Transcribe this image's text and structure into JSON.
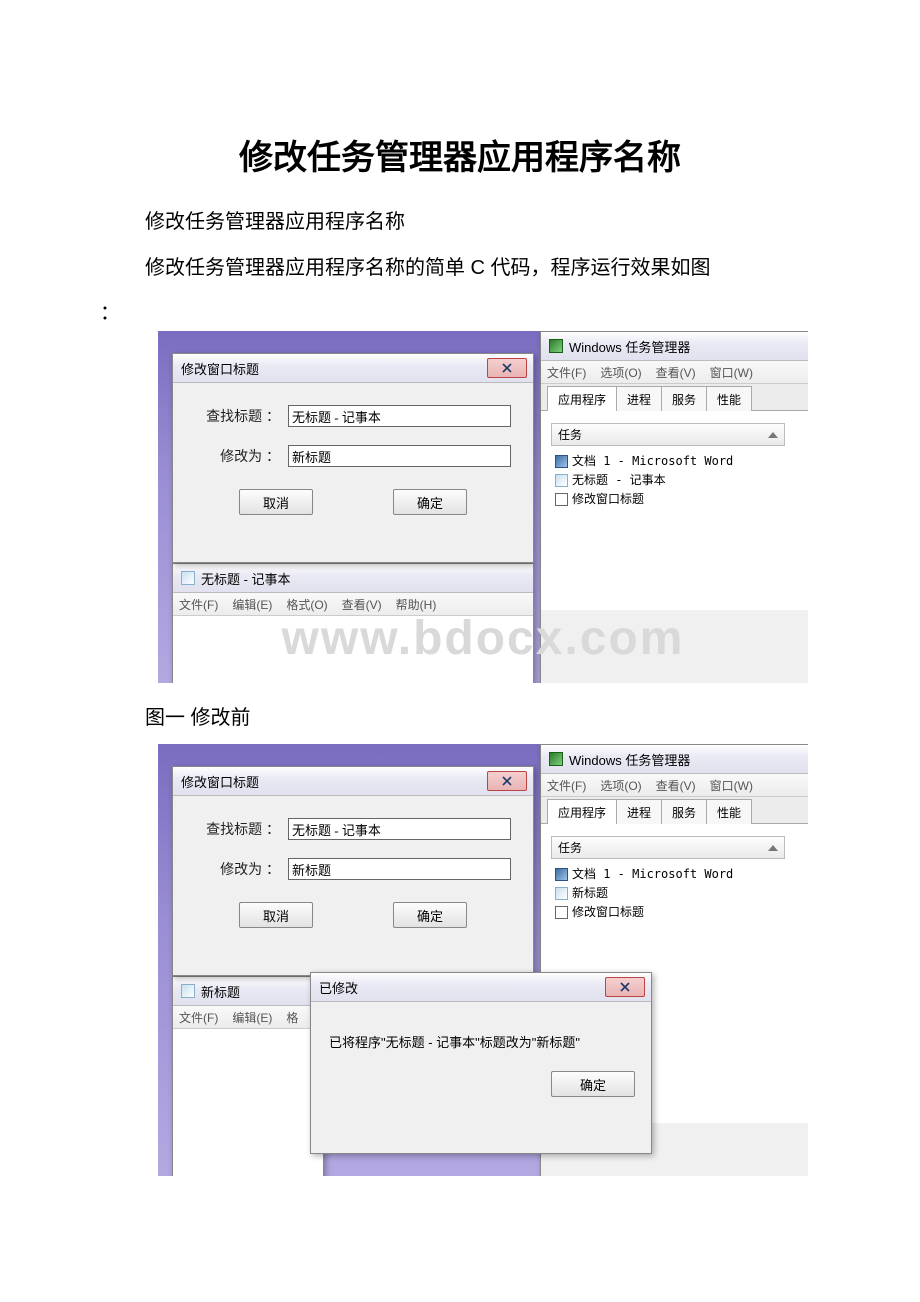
{
  "doc": {
    "title": "修改任务管理器应用程序名称",
    "line1": "修改任务管理器应用程序名称",
    "line2": "修改任务管理器应用程序名称的简单 C 代码，程序运行效果如图",
    "colon": "：",
    "caption1": "图一 修改前",
    "watermark": "www.bdocx.com"
  },
  "dialog": {
    "title": "修改窗口标题",
    "find_label": "查找标题 ：",
    "find_value": "无标题 - 记事本",
    "change_label": "修改为 ：",
    "change_value": "新标题",
    "cancel": "取消",
    "ok": "确定"
  },
  "notepad1": {
    "title": "无标题 - 记事本",
    "menu": [
      "文件(F)",
      "编辑(E)",
      "格式(O)",
      "查看(V)",
      "帮助(H)"
    ]
  },
  "notepad2": {
    "title": "新标题",
    "menu": [
      "文件(F)",
      "编辑(E)",
      "格"
    ]
  },
  "taskmgr": {
    "title": "Windows 任务管理器",
    "menu": [
      "文件(F)",
      "选项(O)",
      "查看(V)",
      "窗口(W)"
    ],
    "tabs": [
      "应用程序",
      "进程",
      "服务",
      "性能"
    ],
    "col_header": "任务",
    "rows1": [
      "文档 1 - Microsoft Word",
      "无标题 - 记事本",
      "修改窗口标题"
    ],
    "rows2": [
      "文档 1 - Microsoft Word",
      "新标题",
      "修改窗口标题"
    ]
  },
  "msgbox": {
    "title": "已修改",
    "text": "已将程序\"无标题 - 记事本\"标题改为\"新标题\"",
    "ok": "确定"
  }
}
